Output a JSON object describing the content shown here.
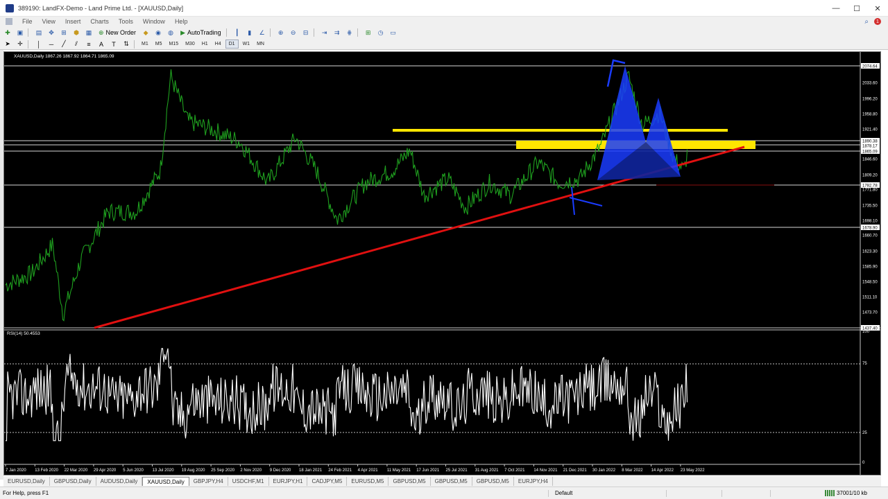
{
  "window": {
    "title": "389190: LandFX-Demo - Land Prime Ltd. - [XAUUSD,Daily]",
    "controls": [
      "—",
      "☐",
      "✕"
    ]
  },
  "menu": [
    "File",
    "View",
    "Insert",
    "Charts",
    "Tools",
    "Window",
    "Help"
  ],
  "notifications_count": "1",
  "toolbar": {
    "new_order_label": "New Order",
    "autotrading_label": "AutoTrading"
  },
  "timeframes": [
    "M1",
    "M5",
    "M15",
    "M30",
    "H1",
    "H4",
    "D1",
    "W1",
    "MN"
  ],
  "active_timeframe": "D1",
  "chart": {
    "header": "XAUUSD,Daily  1867.26 1867.92 1864.71 1865.09",
    "price_labels": [
      "2074.64",
      "2033.60",
      "1996.20",
      "1958.80",
      "1921.40",
      "1890.38",
      "1878.17",
      "1865.09",
      "1846.60",
      "1809.20",
      "1782.78",
      "1771.80",
      "1735.50",
      "1698.10",
      "1678.90",
      "1660.70",
      "1623.30",
      "1585.90",
      "1548.50",
      "1511.10",
      "1473.70",
      "1437.40"
    ],
    "date_labels": [
      "7 Jan 2020",
      "13 Feb 2020",
      "22 Mar 2020",
      "29 Apr 2020",
      "5 Jun 2020",
      "13 Jul 2020",
      "19 Aug 2020",
      "25 Sep 2020",
      "2 Nov 2020",
      "9 Dec 2020",
      "18 Jan 2021",
      "24 Feb 2021",
      "4 Apr 2021",
      "11 May 2021",
      "17 Jun 2021",
      "25 Jul 2021",
      "31 Aug 2021",
      "7 Oct 2021",
      "14 Nov 2021",
      "21 Dec 2021",
      "30 Jan 2022",
      "8 Mar 2022",
      "14 Apr 2022",
      "23 May 2022"
    ],
    "rsi_header": "RSI(14) 50.4553",
    "rsi_levels": [
      "100",
      "75",
      "25",
      "0"
    ],
    "colors": {
      "background": "#000000",
      "price_line": "#1fa01f",
      "trendline": "#e01010",
      "zone": "#ffe600",
      "pattern": "#1a3cff",
      "rsi": "#ffffff"
    }
  },
  "tabs": [
    "EURUSD,Daily",
    "GBPUSD,Daily",
    "AUDUSD,Daily",
    "XAUUSD,Daily",
    "GBPJPY,H4",
    "USDCHF,M1",
    "EURJPY,H1",
    "CADJPY,M5",
    "EURUSD,M5",
    "GBPUSD,M5",
    "GBPUSD,M5",
    "GBPUSD,M5",
    "EURJPY,H4"
  ],
  "active_tab": "XAUUSD,Daily",
  "status": {
    "help": "For Help, press F1",
    "profile": "Default",
    "traffic": "37001/10 kb"
  }
}
